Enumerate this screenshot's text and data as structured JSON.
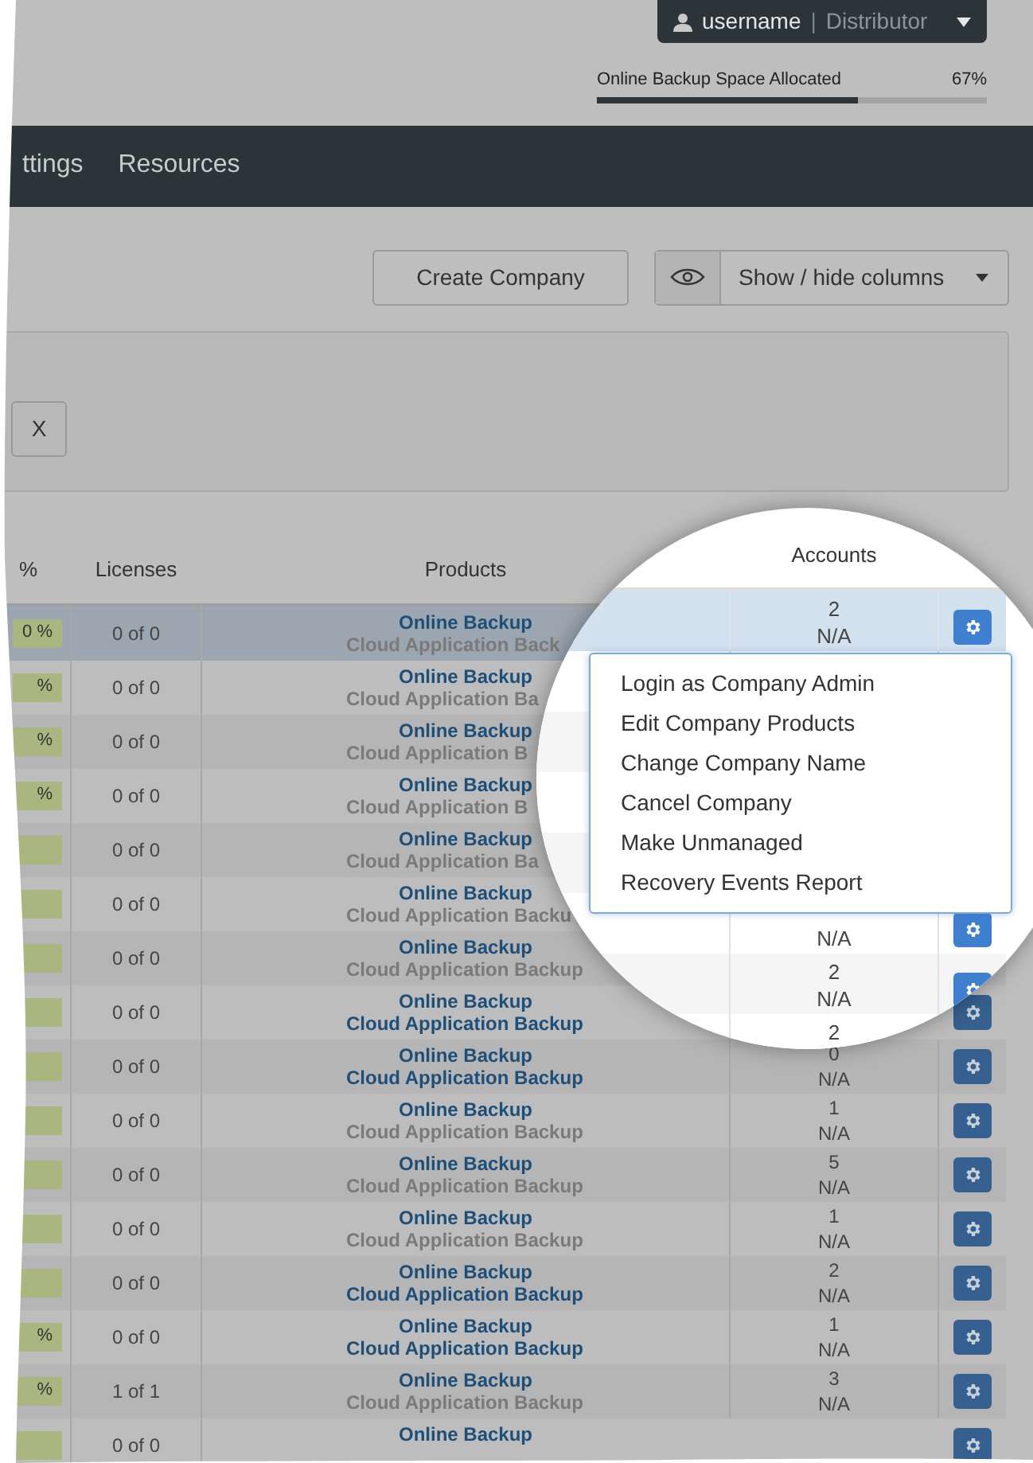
{
  "user_menu": {
    "username": "username",
    "separator": "|",
    "role": "Distributor"
  },
  "quota": {
    "label": "Online Backup Space Allocated",
    "reading": "67%",
    "level": 0.67
  },
  "nav": {
    "items": [
      {
        "label": "ttings"
      },
      {
        "label": "Resources"
      }
    ]
  },
  "toolbar": {
    "create_button": "Create Company",
    "columns_button": "Show / hide columns"
  },
  "filter": {
    "clear_button": "X"
  },
  "table": {
    "columns": [
      "%",
      "Licenses",
      "Products"
    ],
    "rows": [
      {
        "usage": "0 %",
        "licenses": "0 of 0",
        "selected": true,
        "products": [
          {
            "name": "Online Backup",
            "active": true
          },
          {
            "name": "Cloud Application Back",
            "active": false
          }
        ]
      },
      {
        "usage": "%",
        "licenses": "0 of 0",
        "selected": false,
        "products": [
          {
            "name": "Online Backup",
            "active": true
          },
          {
            "name": "Cloud Application Ba",
            "active": false
          }
        ]
      },
      {
        "usage": "%",
        "licenses": "0 of 0",
        "selected": false,
        "products": [
          {
            "name": "Online Backup",
            "active": true
          },
          {
            "name": "Cloud Application B",
            "active": false
          }
        ]
      },
      {
        "usage": "%",
        "licenses": "0 of 0",
        "selected": false,
        "products": [
          {
            "name": "Online Backup",
            "active": true
          },
          {
            "name": "Cloud Application B",
            "active": false
          }
        ]
      },
      {
        "licenses": "0 of 0",
        "selected": false,
        "products": [
          {
            "name": "Online Backup",
            "active": true
          },
          {
            "name": "Cloud Application Ba",
            "active": false
          }
        ]
      },
      {
        "licenses": "0 of 0",
        "selected": false,
        "products": [
          {
            "name": "Online Backup",
            "active": true
          },
          {
            "name": "Cloud Application Backu",
            "active": false
          }
        ]
      },
      {
        "licenses": "0 of 0",
        "selected": false,
        "products": [
          {
            "name": "Online Backup",
            "active": true
          },
          {
            "name": "Cloud Application Backup",
            "active": false
          }
        ]
      },
      {
        "licenses": "0 of 0",
        "selected": false,
        "products": [
          {
            "name": "Online Backup",
            "active": true
          },
          {
            "name": "Cloud Application Backup",
            "active": true
          }
        ],
        "action": true
      },
      {
        "licenses": "0 of 0",
        "selected": false,
        "products": [
          {
            "name": "Online Backup",
            "active": true
          },
          {
            "name": "Cloud Application Backup",
            "active": true
          }
        ],
        "accounts": [
          "0",
          "N/A"
        ],
        "action": true
      },
      {
        "licenses": "0 of 0",
        "selected": false,
        "products": [
          {
            "name": "Online Backup",
            "active": true
          },
          {
            "name": "Cloud Application Backup",
            "active": false
          }
        ],
        "accounts": [
          "1",
          "N/A"
        ],
        "action": true
      },
      {
        "licenses": "0 of 0",
        "selected": false,
        "products": [
          {
            "name": "Online Backup",
            "active": true
          },
          {
            "name": "Cloud Application Backup",
            "active": false
          }
        ],
        "accounts": [
          "5",
          "N/A"
        ],
        "action": true
      },
      {
        "licenses": "0 of 0",
        "selected": false,
        "products": [
          {
            "name": "Online Backup",
            "active": true
          },
          {
            "name": "Cloud Application Backup",
            "active": false
          }
        ],
        "accounts": [
          "1",
          "N/A"
        ],
        "action": true
      },
      {
        "licenses": "0 of 0",
        "selected": false,
        "products": [
          {
            "name": "Online Backup",
            "active": true
          },
          {
            "name": "Cloud Application Backup",
            "active": true
          }
        ],
        "accounts": [
          "2",
          "N/A"
        ],
        "action": true
      },
      {
        "usage": "%",
        "licenses": "0 of 0",
        "selected": false,
        "products": [
          {
            "name": "Online Backup",
            "active": true
          },
          {
            "name": "Cloud Application Backup",
            "active": true
          }
        ],
        "accounts": [
          "1",
          "N/A"
        ],
        "action": true
      },
      {
        "usage": "%",
        "licenses": "1 of 1",
        "selected": false,
        "products": [
          {
            "name": "Online Backup",
            "active": true
          },
          {
            "name": "Cloud Application Backup",
            "active": false
          }
        ],
        "accounts": [
          "3",
          "N/A"
        ],
        "action": true
      },
      {
        "licenses": "0 of 0",
        "selected": false,
        "products": [
          {
            "name": "Online Backup",
            "active": true
          }
        ],
        "action": true
      }
    ]
  },
  "magnifier": {
    "header": "Accounts",
    "rows": [
      {
        "accounts": [
          "2",
          "N/A"
        ],
        "selected": true,
        "action": true
      },
      {
        "selected": false,
        "action": false
      },
      {
        "selected": false,
        "action": false
      },
      {
        "selected": false,
        "action": false
      },
      {
        "selected": false,
        "action": false
      },
      {
        "accounts": [
          "N/A"
        ],
        "selected": false,
        "action": true
      },
      {
        "accounts": [
          "2",
          "N/A"
        ],
        "selected": false,
        "action": true
      },
      {
        "accounts": [
          "2"
        ],
        "selected": false,
        "action": false
      }
    ],
    "menu": [
      "Login as Company Admin",
      "Edit Company Products",
      "Change Company Name",
      "Cancel Company",
      "Make Unmanaged",
      "Recovery Events Report"
    ]
  }
}
